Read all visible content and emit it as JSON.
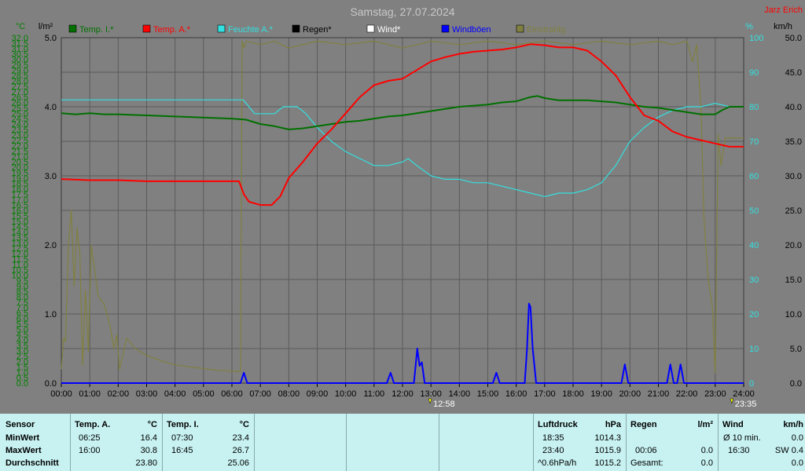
{
  "title": "Samstag, 27.07.2024",
  "author": "Jarz Erich",
  "colors": {
    "temp_in": "#007000",
    "temp_out": "#ff0000",
    "humidity": "#33e0e0",
    "rain": "#000000",
    "wind": "#ffffff",
    "gust": "#0000ff",
    "radiation": "#808040",
    "plot_bg": "#808080",
    "grid": "#5a5a5a",
    "left_axis": "#008000",
    "right_axis": "#000000",
    "pct_axis": "#33e0e0",
    "table_bg": "#c8f2f2"
  },
  "chart_data": {
    "type": "line",
    "title": "Samstag, 27.07.2024",
    "grid": true,
    "legend_position": "top",
    "x_ticks": [
      "00:00",
      "01:00",
      "02:00",
      "03:00",
      "04:00",
      "05:00",
      "06:00",
      "07:00",
      "08:00",
      "09:00",
      "10:00",
      "11:00",
      "12:00",
      "13:00",
      "14:00",
      "15:00",
      "16:00",
      "17:00",
      "18:00",
      "19:00",
      "20:00",
      "21:00",
      "22:00",
      "23:00",
      "24:00"
    ],
    "x_range_hours": [
      0,
      24
    ],
    "axes": {
      "temp": {
        "unit": "°C",
        "range": [
          0,
          32
        ],
        "step": 0.5,
        "ticks": [
          "0.0",
          "0.5",
          "1.0",
          "1.5",
          "2.0",
          "2.5",
          "3.0",
          "3.5",
          "4.0",
          "4.5",
          "5.0",
          "5.5",
          "6.0",
          "6.5",
          "7.0",
          "7.5",
          "8.0",
          "8.5",
          "9.0",
          "9.5",
          "10.0",
          "10.5",
          "11.0",
          "11.5",
          "12.0",
          "12.5",
          "13.0",
          "13.5",
          "14.0",
          "14.5",
          "15.0",
          "15.5",
          "16.0",
          "16.5",
          "17.0",
          "17.5",
          "18.0",
          "18.5",
          "19.0",
          "19.5",
          "20.0",
          "20.5",
          "21.0",
          "21.5",
          "22.0",
          "22.5",
          "23.0",
          "23.5",
          "24.0",
          "24.5",
          "25.0",
          "25.5",
          "26.0",
          "26.5",
          "27.0",
          "27.5",
          "28.0",
          "28.5",
          "29.0",
          "29.5",
          "30.0",
          "30.5",
          "31.0",
          "31.5",
          "32.0"
        ]
      },
      "rain": {
        "unit": "l/m²",
        "range": [
          0,
          5
        ],
        "ticks": [
          "0.0",
          "1.0",
          "2.0",
          "3.0",
          "4.0",
          "5.0"
        ]
      },
      "humidity": {
        "unit": "%",
        "range": [
          0,
          100
        ],
        "ticks": [
          "0",
          "10",
          "20",
          "30",
          "40",
          "50",
          "60",
          "70",
          "80",
          "90",
          "100"
        ]
      },
      "wind": {
        "unit": "km/h",
        "range": [
          0,
          50
        ],
        "ticks": [
          "0.0",
          "5.0",
          "10.0",
          "15.0",
          "20.0",
          "25.0",
          "30.0",
          "35.0",
          "40.0",
          "45.0",
          "50.0"
        ]
      }
    },
    "series": [
      {
        "name": "Temp. I.*",
        "key": "temp_in",
        "axis": "temp",
        "color": "#007000",
        "x": [
          0,
          0.5,
          1,
          1.5,
          2,
          3,
          4,
          5,
          6,
          6.5,
          7,
          7.5,
          8,
          8.5,
          9,
          9.5,
          10,
          10.5,
          11,
          11.5,
          12,
          12.5,
          13,
          13.5,
          14,
          14.5,
          15,
          15.5,
          16,
          16.5,
          16.75,
          17,
          17.5,
          18,
          18.5,
          19,
          19.5,
          20,
          20.5,
          21,
          21.5,
          22,
          22.5,
          23,
          23.25,
          23.5,
          24
        ],
        "y": [
          25.0,
          24.9,
          25.0,
          24.9,
          24.9,
          24.8,
          24.7,
          24.6,
          24.5,
          24.4,
          24.0,
          23.8,
          23.5,
          23.6,
          23.8,
          24.0,
          24.2,
          24.3,
          24.5,
          24.7,
          24.8,
          25.0,
          25.2,
          25.4,
          25.6,
          25.7,
          25.8,
          26.0,
          26.1,
          26.5,
          26.6,
          26.4,
          26.2,
          26.2,
          26.2,
          26.1,
          26.0,
          25.8,
          25.6,
          25.5,
          25.3,
          25.1,
          24.9,
          24.9,
          25.3,
          25.6,
          25.6
        ]
      },
      {
        "name": "Temp. A.*",
        "key": "temp_out",
        "axis": "temp",
        "color": "#ff0000",
        "x": [
          0,
          1,
          2,
          3,
          4,
          5,
          6,
          6.25,
          6.42,
          6.6,
          7,
          7.4,
          7.7,
          8,
          8.5,
          9,
          9.5,
          10,
          10.5,
          11,
          11.5,
          12,
          12.5,
          13,
          13.5,
          14,
          14.5,
          15,
          15.5,
          16,
          16.5,
          17,
          17.5,
          18,
          18.5,
          19,
          19.5,
          20,
          20.5,
          21,
          21.5,
          22,
          22.5,
          23,
          23.5,
          24
        ],
        "y": [
          18.9,
          18.8,
          18.8,
          18.7,
          18.7,
          18.7,
          18.7,
          18.7,
          17.5,
          16.8,
          16.5,
          16.5,
          17.3,
          19.0,
          20.5,
          22.2,
          23.5,
          25.0,
          26.5,
          27.6,
          28.0,
          28.2,
          29.0,
          29.8,
          30.2,
          30.5,
          30.7,
          30.8,
          30.9,
          31.1,
          31.4,
          31.3,
          31.1,
          31.1,
          30.8,
          29.8,
          28.5,
          26.5,
          24.8,
          24.3,
          23.3,
          22.8,
          22.5,
          22.2,
          21.9,
          21.9
        ]
      },
      {
        "name": "Feuchte A.*",
        "key": "humidity",
        "axis": "humidity",
        "color": "#33e0e0",
        "x": [
          0,
          1,
          2,
          3,
          4,
          5,
          6,
          6.4,
          6.8,
          7.5,
          7.8,
          8.3,
          8.6,
          9,
          9.5,
          10,
          10.5,
          11,
          11.5,
          12,
          12.2,
          12.5,
          13,
          13.5,
          14,
          14.5,
          15,
          15.5,
          16,
          16.5,
          17,
          17.5,
          18,
          18.5,
          19,
          19.5,
          20,
          20.5,
          21,
          21.5,
          22,
          22.5,
          23,
          23.5,
          24
        ],
        "y": [
          82,
          82,
          82,
          82,
          82,
          82,
          82,
          82,
          78,
          78,
          80,
          80,
          78,
          74,
          70,
          67,
          65,
          63,
          63,
          64,
          65,
          63,
          60,
          59,
          59,
          58,
          58,
          57,
          56,
          55,
          54,
          55,
          55,
          56,
          58,
          63,
          70,
          74,
          77,
          79,
          80,
          80,
          81,
          80,
          80
        ]
      },
      {
        "name": "Regen*",
        "key": "rain",
        "axis": "rain",
        "color": "#000000",
        "x": [
          0,
          24
        ],
        "y": [
          0,
          0
        ]
      },
      {
        "name": "Wind*",
        "key": "wind",
        "axis": "wind",
        "color": "#ffffff",
        "x": [
          0,
          24
        ],
        "y": [
          0,
          0
        ]
      },
      {
        "name": "Windböen",
        "key": "gust",
        "axis": "wind",
        "color": "#0000ff",
        "x": [
          0,
          6.3,
          6.42,
          6.54,
          11.45,
          11.58,
          11.7,
          12.4,
          12.52,
          12.6,
          12.68,
          12.78,
          15.18,
          15.3,
          15.42,
          16.3,
          16.38,
          16.45,
          16.5,
          16.58,
          16.7,
          19.7,
          19.82,
          19.94,
          21.3,
          21.42,
          21.54,
          21.66,
          21.78,
          21.9,
          24
        ],
        "y": [
          0,
          0,
          1.5,
          0,
          0,
          1.5,
          0,
          0,
          5,
          2.5,
          3,
          0,
          0,
          1.5,
          0,
          0,
          5,
          11.5,
          11,
          5,
          0,
          0,
          2.7,
          0,
          0,
          2.7,
          0,
          0,
          2.7,
          0,
          0
        ]
      },
      {
        "name": "Einstrahlg.",
        "key": "radiation",
        "axis": "humidity",
        "color": "#808040",
        "x": [
          0,
          0.08,
          0.15,
          0.25,
          0.35,
          0.45,
          0.55,
          0.65,
          0.75,
          0.85,
          0.95,
          1.05,
          1.15,
          1.3,
          1.5,
          1.7,
          1.85,
          1.95,
          2.05,
          2.3,
          2.6,
          3,
          3.5,
          4,
          4.5,
          5,
          5.5,
          6,
          6.3,
          6.36,
          6.42,
          6.5,
          7,
          7.5,
          8,
          9,
          10,
          11,
          12,
          13,
          14,
          15,
          16,
          17,
          18,
          19,
          20,
          21,
          21.5,
          22,
          22.2,
          22.35,
          22.5,
          22.6,
          22.75,
          22.9,
          23.0,
          23.1,
          23.2,
          23.35,
          23.5,
          24
        ],
        "y": [
          4,
          13,
          12,
          40,
          50,
          28,
          45,
          38,
          5,
          27,
          9,
          40,
          34,
          25,
          23,
          17,
          10,
          14,
          4,
          13,
          10,
          8,
          6.5,
          5.3,
          4.7,
          4.2,
          3.7,
          3.5,
          3.3,
          99,
          97,
          99,
          98,
          99,
          97,
          99,
          98,
          99,
          97,
          99,
          98,
          99,
          98,
          99,
          98,
          99,
          98,
          99,
          98,
          99,
          93,
          98,
          79,
          48,
          30,
          22,
          3,
          72,
          63,
          71,
          71,
          71
        ]
      }
    ],
    "markers": [
      {
        "label": "12:58",
        "hour": 12.97,
        "icon": "sun-marker-icon"
      },
      {
        "label": "23:35",
        "hour": 23.58,
        "icon": "sun-marker-icon"
      }
    ]
  },
  "table": {
    "sensor": {
      "header": "Sensor",
      "rows": [
        "MinWert",
        "MaxWert",
        "Durchschnitt"
      ]
    },
    "temp_a": {
      "header": "Temp. A.",
      "unit": "°C",
      "times": [
        "06:25",
        "16:00"
      ],
      "values": [
        "16.4",
        "30.8"
      ],
      "avg": "23.80"
    },
    "temp_i": {
      "header": "Temp. I.",
      "unit": "°C",
      "times": [
        "07:30",
        "16:45"
      ],
      "values": [
        "23.4",
        "26.7"
      ],
      "avg": "25.06"
    },
    "luftdruck": {
      "header": "Luftdruck",
      "unit": "hPa",
      "times": [
        "18:35",
        "23:40",
        "^0.6hPa/h"
      ],
      "values": [
        "1014.3",
        "1015.9",
        "1015.2"
      ]
    },
    "regen": {
      "header": "Regen",
      "unit": "l/m²",
      "times": [
        "",
        "00:06",
        "Gesamt:"
      ],
      "values": [
        "",
        "0.0",
        "0.0"
      ]
    },
    "wind": {
      "header": "Wind",
      "unit": "km/h",
      "times": [
        "Ø 10 min.",
        "16:30",
        ""
      ],
      "values": [
        "0.0",
        "SW 0.4",
        "0.0"
      ]
    }
  }
}
